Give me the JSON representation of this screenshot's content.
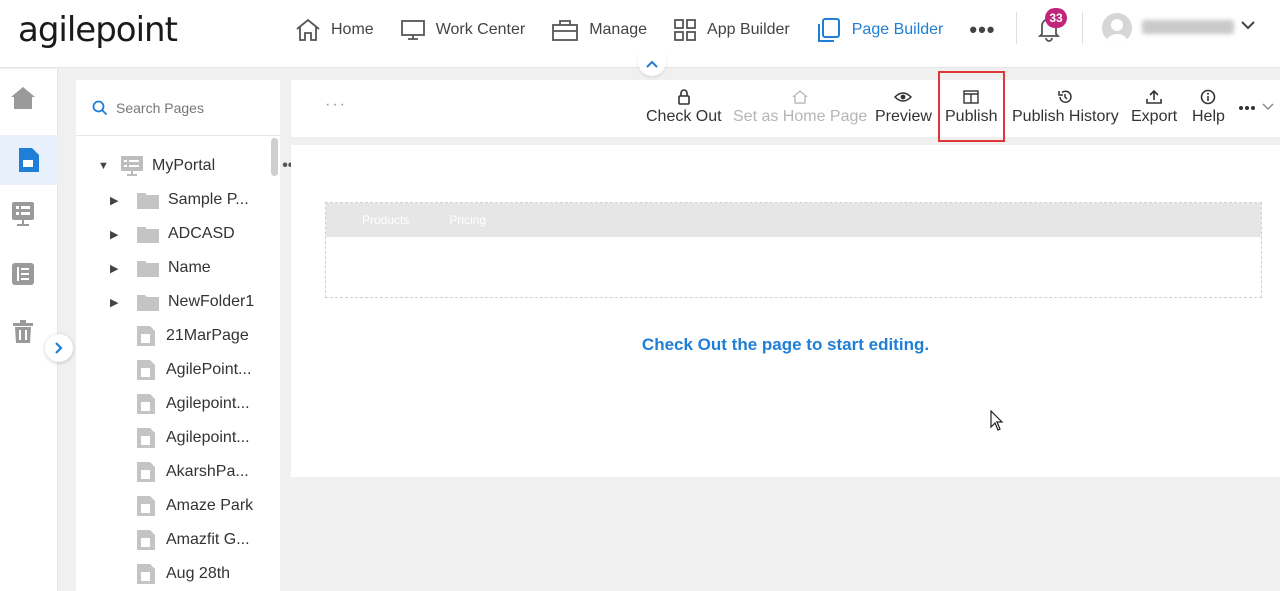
{
  "brand": {
    "logo_text": "agilepoint"
  },
  "nav": {
    "items": [
      {
        "label": "Home",
        "icon": "home-icon"
      },
      {
        "label": "Work Center",
        "icon": "monitor-icon"
      },
      {
        "label": "Manage",
        "icon": "briefcase-icon"
      },
      {
        "label": "App Builder",
        "icon": "grid-icon"
      },
      {
        "label": "Page Builder",
        "icon": "pages-icon",
        "active": true
      }
    ],
    "more": "•••",
    "notification_count": "33"
  },
  "colors": {
    "accent": "#1f7fd6",
    "badge": "#c0267a",
    "highlight": "#e0353b"
  },
  "search": {
    "placeholder": "Search Pages"
  },
  "tree": {
    "root": {
      "label": "MyPortal"
    },
    "folders": [
      {
        "label": "Sample P..."
      },
      {
        "label": "ADCASD"
      },
      {
        "label": "Name"
      },
      {
        "label": "NewFolder1"
      }
    ],
    "pages": [
      {
        "label": "21MarPage"
      },
      {
        "label": "AgilePoint..."
      },
      {
        "label": "Agilepoint..."
      },
      {
        "label": "Agilepoint..."
      },
      {
        "label": "AkarshPa..."
      },
      {
        "label": "Amaze Park"
      },
      {
        "label": "Amazfit G..."
      },
      {
        "label": "Aug 28th"
      }
    ]
  },
  "toolbar": {
    "breadcrumb": "···",
    "check_out": "Check Out",
    "set_home": "Set as Home Page",
    "preview": "Preview",
    "publish": "Publish",
    "publish_history": "Publish History",
    "export": "Export",
    "help": "Help"
  },
  "canvas": {
    "menu_items": [
      "Products",
      "Pricing"
    ],
    "message": "Check Out the page to start editing."
  }
}
